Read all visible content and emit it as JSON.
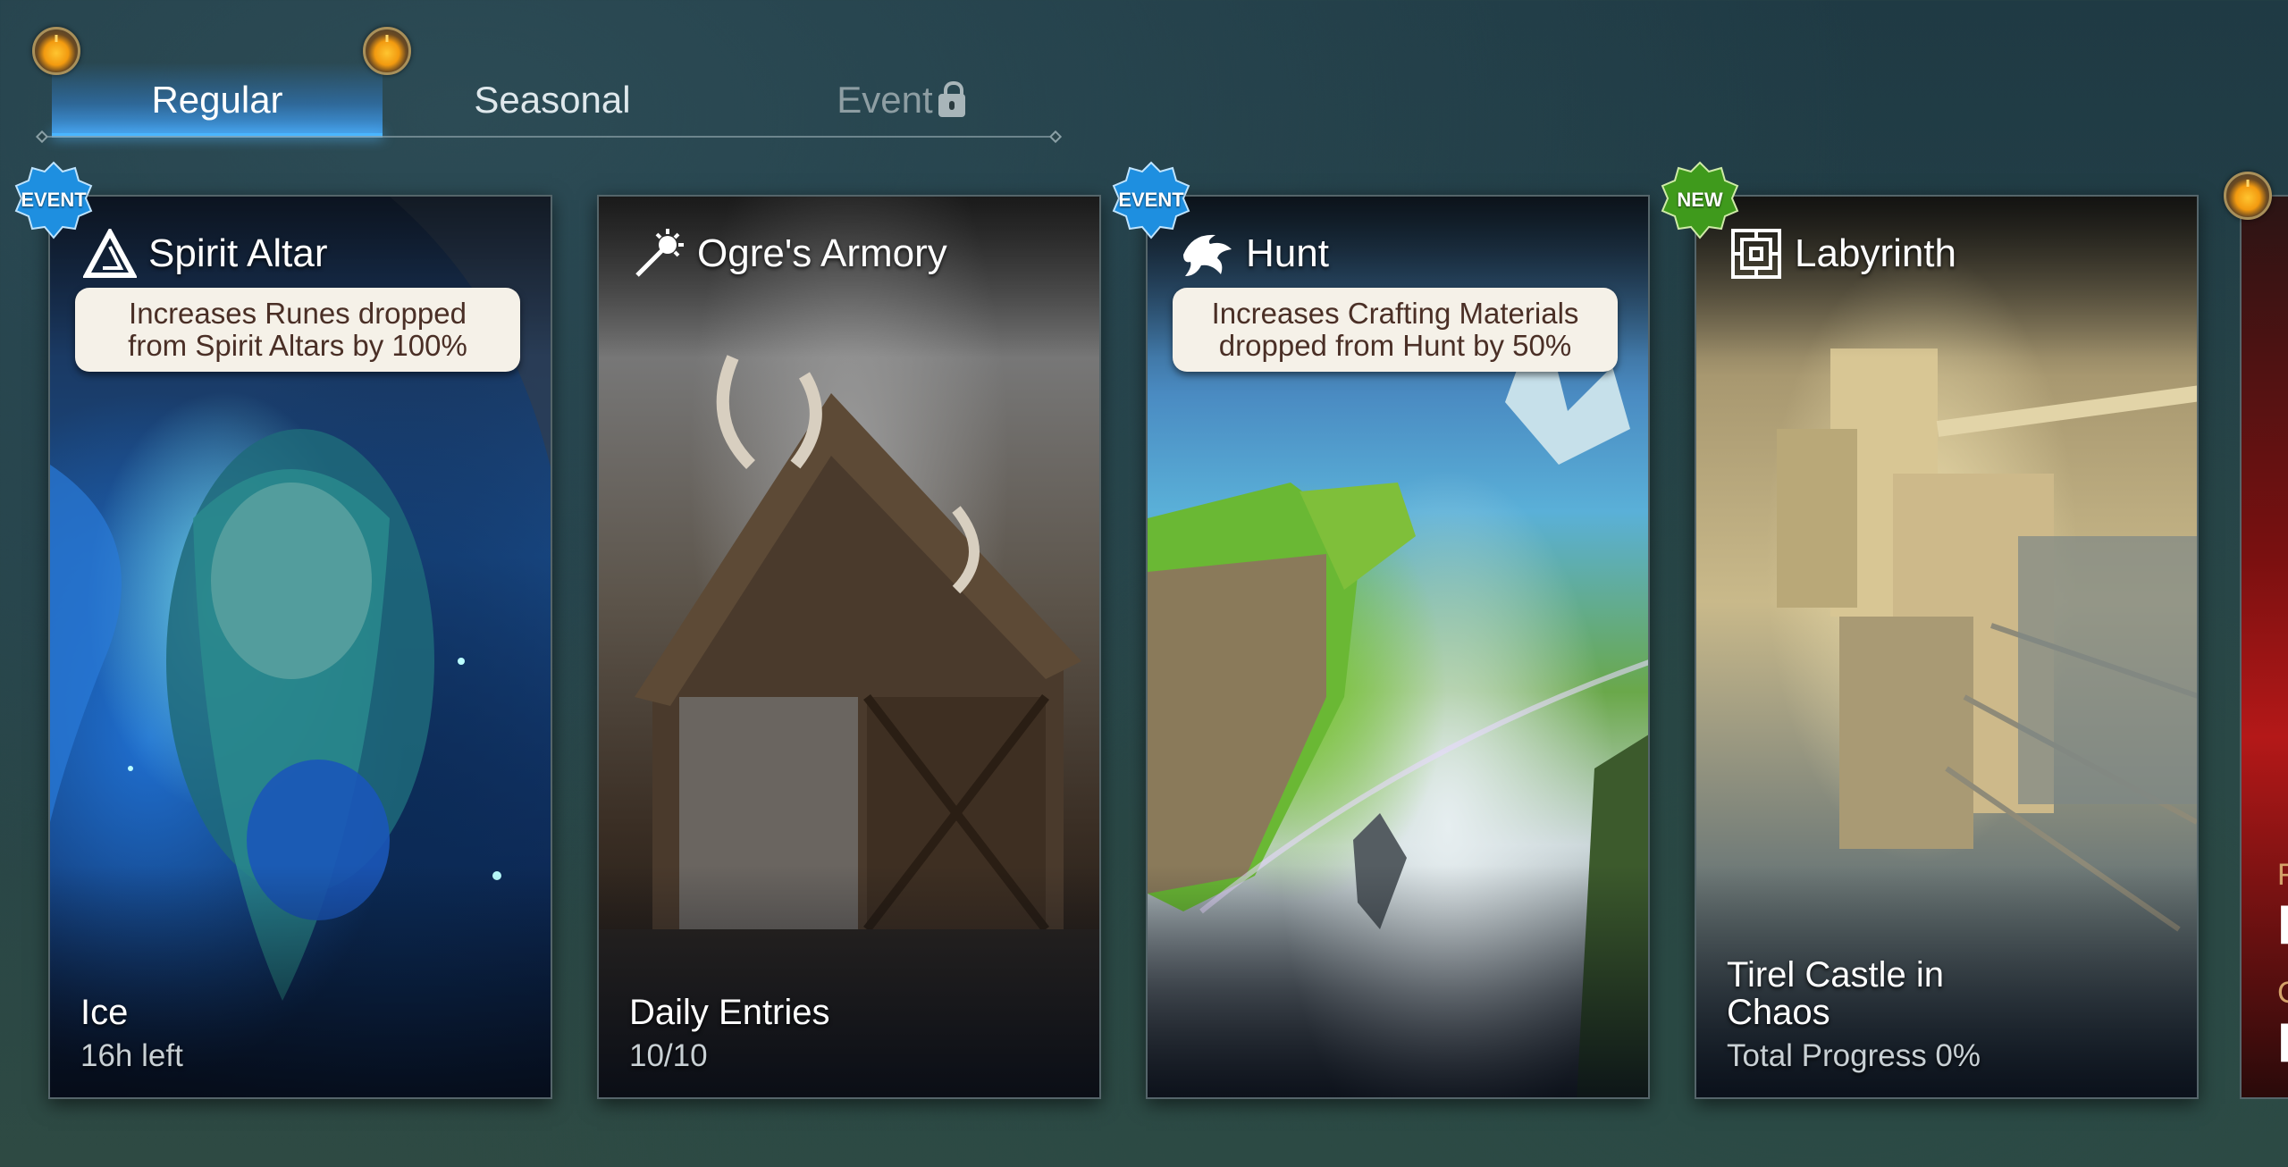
{
  "tabs": {
    "regular": "Regular",
    "seasonal": "Seasonal",
    "event": "Event"
  },
  "cards": [
    {
      "title": "Spirit Altar",
      "badge": "EVENT",
      "bonus_line1": "Increases Runes dropped",
      "bonus_line2": "from Spirit Altars by 100%",
      "footer_main": "Ice",
      "footer_sub": "16h left",
      "icon": "triangle-rune-icon"
    },
    {
      "title": "Ogre's Armory",
      "footer_main": "Daily Entries",
      "footer_sub": "10/10",
      "icon": "mace-icon"
    },
    {
      "title": "Hunt",
      "badge": "EVENT",
      "bonus_line1": "Increases Crafting Materials",
      "bonus_line2": "dropped from Hunt by 50%",
      "icon": "dragon-icon"
    },
    {
      "title": "Labyrinth",
      "badge": "NEW",
      "footer_main_line1": "Tirel Castle in",
      "footer_main_line2": "Chaos",
      "footer_sub": "Total Progress 0%",
      "icon": "maze-icon"
    }
  ],
  "partial_card": {
    "letter1": "F",
    "letter2": "F",
    "small1": "F",
    "small2": "C"
  },
  "colors": {
    "event_badge": "#1e8fe0",
    "new_badge": "#3f9a1c",
    "tab_active": "#4ab5ff",
    "bonus_bg": "#f5f1e8",
    "bonus_text": "#4a2f26"
  }
}
